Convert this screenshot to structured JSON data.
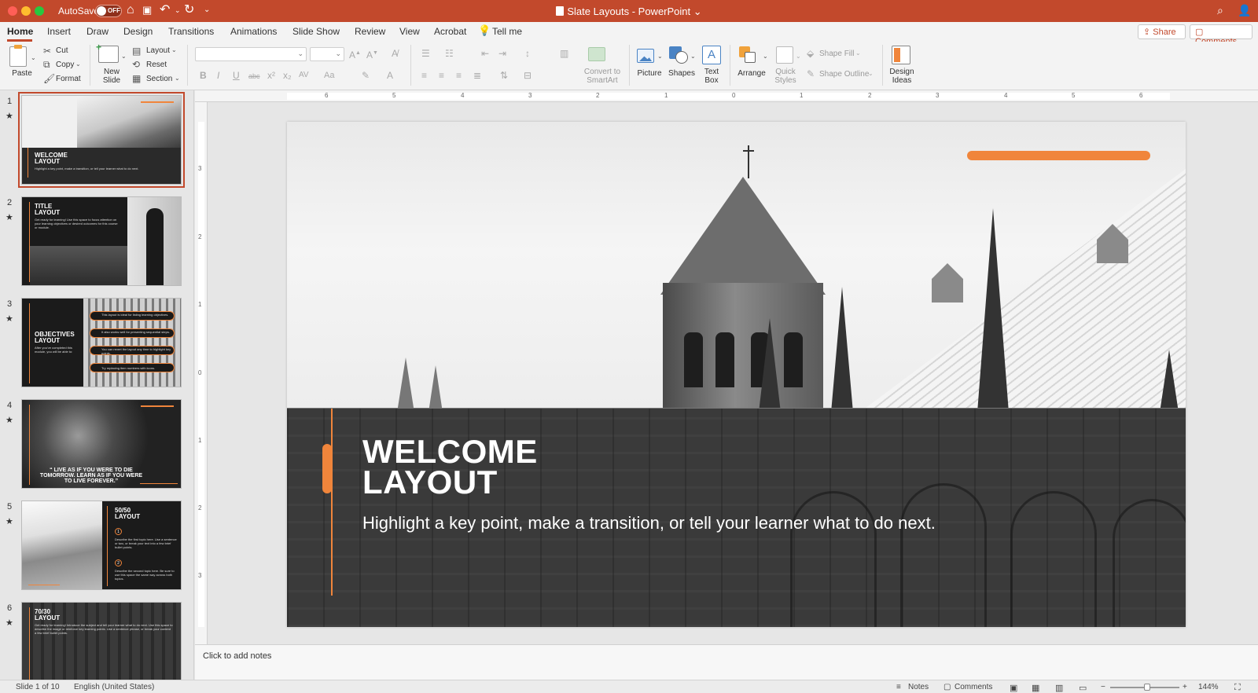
{
  "titlebar": {
    "autosave_label": "AutoSave",
    "autosave_state": "OFF",
    "title": "Slate Layouts - PowerPoint",
    "title_chevron": "⌄",
    "icons": [
      "home-icon",
      "save-icon",
      "undo-icon",
      "redo-icon",
      "customize-icon",
      "search-icon",
      "account-icon"
    ]
  },
  "tabs": [
    "Home",
    "Insert",
    "Draw",
    "Design",
    "Transitions",
    "Animations",
    "Slide Show",
    "Review",
    "View",
    "Acrobat"
  ],
  "tell_me": "Tell me",
  "share": "Share",
  "comments": "Comments",
  "ribbon": {
    "paste": "Paste",
    "cut": "Cut",
    "copy": "Copy",
    "format": "Format",
    "new_slide": [
      "New",
      "Slide"
    ],
    "layout": "Layout",
    "reset": "Reset",
    "section": "Section",
    "convert_smartart": [
      "Convert to",
      "SmartArt"
    ],
    "picture": "Picture",
    "shapes": "Shapes",
    "text_box": [
      "Text",
      "Box"
    ],
    "arrange": "Arrange",
    "quick_styles": [
      "Quick",
      "Styles"
    ],
    "shape_fill": "Shape Fill",
    "shape_outline": "Shape Outline",
    "design_ideas": [
      "Design",
      "Ideas"
    ],
    "font_buttons": [
      "B",
      "I",
      "U",
      "abc",
      "x²",
      "x₂",
      "AV",
      "Aa",
      "A"
    ]
  },
  "thumbnails": [
    {
      "num": "1",
      "title": [
        "WELCOME",
        "LAYOUT"
      ],
      "body": "Highlight a key point, make a transition, or tell your learner what to do next."
    },
    {
      "num": "2",
      "title": [
        "TITLE",
        "LAYOUT"
      ],
      "body": "Get ready for learning! Use this space to focus attention on your learning objectives or desired outcomes for this course or module."
    },
    {
      "num": "3",
      "title": [
        "OBJECTIVES",
        "LAYOUT"
      ],
      "body": "After you've completed this module, you will be able to:",
      "items": [
        "This layout is ideal for listing learning objectives.",
        "It also works well for presenting sequential steps.",
        "You can revert the layout any time to highlight key points.",
        "Try replacing item numbers with icons."
      ]
    },
    {
      "num": "4",
      "quote": "“ LIVE AS IF YOU WERE TO DIE TOMORROW. LEARN AS IF YOU WERE TO LIVE FOREVER.”"
    },
    {
      "num": "5",
      "title": [
        "50/50",
        "LAYOUT"
      ],
      "items": [
        "Describe the first topic here. Use a sentence or two, or break your text into a few brief bullet points.",
        "Describe the second topic here. Be sure to use this space the same way across both topics."
      ]
    },
    {
      "num": "6",
      "title": [
        "70/30",
        "LAYOUT"
      ],
      "body": "Get ready for learning! Introduce the subject and tell your learner what to do next. Use this space to describe the image or reinforce key learning points. Use a sentence phrase, or break your content a few brief bullet points."
    }
  ],
  "ruler_h": [
    "6",
    "5",
    "4",
    "3",
    "2",
    "1",
    "0",
    "1",
    "2",
    "3",
    "4",
    "5",
    "6"
  ],
  "ruler_v": [
    "3",
    "2",
    "1",
    "0",
    "1",
    "2",
    "3"
  ],
  "slide": {
    "title": [
      "WELCOME",
      "LAYOUT"
    ],
    "subtitle": "Highlight a key point, make a transition, or tell your learner what to do next."
  },
  "notes_placeholder": "Click to add notes",
  "status": {
    "slide_of": "Slide 1 of 10",
    "language": "English (United States)",
    "notes": "Notes",
    "comments": "Comments",
    "zoom": "144%"
  },
  "colors": {
    "accent": "#c2492c",
    "slide_orange": "#f0853b"
  }
}
